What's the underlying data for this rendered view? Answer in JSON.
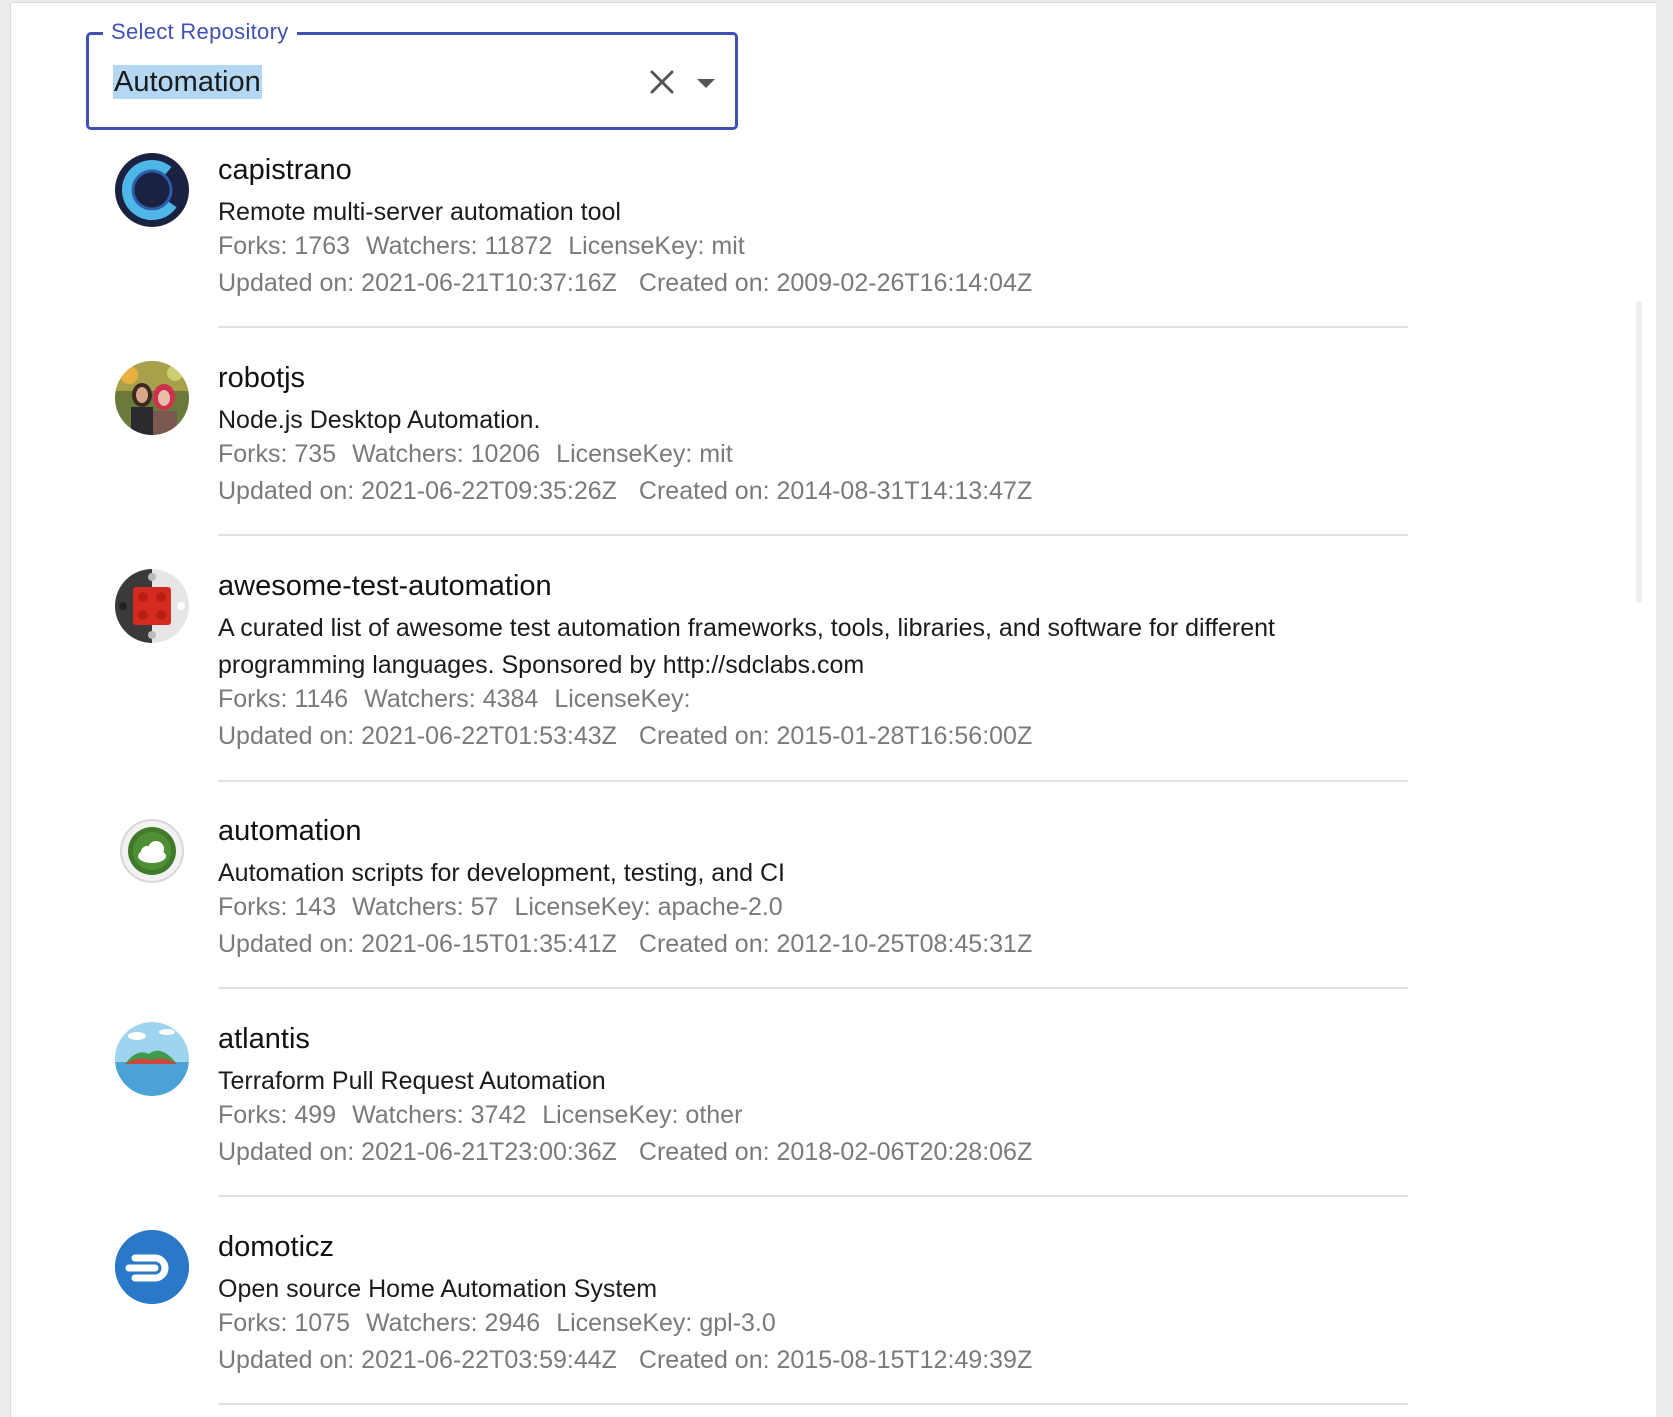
{
  "select": {
    "label": "Select Repository",
    "value": "Automation"
  },
  "icons": {
    "clear": "close-icon",
    "dropdown": "arrow-drop-down-icon"
  },
  "repos": [
    {
      "name": "capistrano",
      "description": "Remote multi-server automation tool",
      "forks": "Forks: 1763",
      "watchers": "Watchers: 11872",
      "license": "LicenseKey: mit",
      "updated": "Updated on: 2021-06-21T10:37:16Z",
      "created": "Created on: 2009-02-26T16:14:04Z"
    },
    {
      "name": "robotjs",
      "description": "Node.js Desktop Automation.",
      "forks": "Forks: 735",
      "watchers": "Watchers: 10206",
      "license": "LicenseKey: mit",
      "updated": "Updated on: 2021-06-22T09:35:26Z",
      "created": "Created on: 2014-08-31T14:13:47Z"
    },
    {
      "name": "awesome-test-automation",
      "description": "A curated list of awesome test automation frameworks, tools, libraries, and software for different programming languages. Sponsored by http://sdclabs.com",
      "forks": "Forks: 1146",
      "watchers": "Watchers: 4384",
      "license": "LicenseKey:",
      "updated": "Updated on: 2021-06-22T01:53:43Z",
      "created": "Created on: 2015-01-28T16:56:00Z"
    },
    {
      "name": "automation",
      "description": "Automation scripts for development, testing, and CI",
      "forks": "Forks: 143",
      "watchers": "Watchers: 57",
      "license": "LicenseKey: apache-2.0",
      "updated": "Updated on: 2021-06-15T01:35:41Z",
      "created": "Created on: 2012-10-25T08:45:31Z"
    },
    {
      "name": "atlantis",
      "description": "Terraform Pull Request Automation",
      "forks": "Forks: 499",
      "watchers": "Watchers: 3742",
      "license": "LicenseKey: other",
      "updated": "Updated on: 2021-06-21T23:00:36Z",
      "created": "Created on: 2018-02-06T20:28:06Z"
    },
    {
      "name": "domoticz",
      "description": "Open source Home Automation System",
      "forks": "Forks: 1075",
      "watchers": "Watchers: 2946",
      "license": "LicenseKey: gpl-3.0",
      "updated": "Updated on: 2021-06-22T03:59:44Z",
      "created": "Created on: 2015-08-15T12:49:39Z"
    }
  ]
}
